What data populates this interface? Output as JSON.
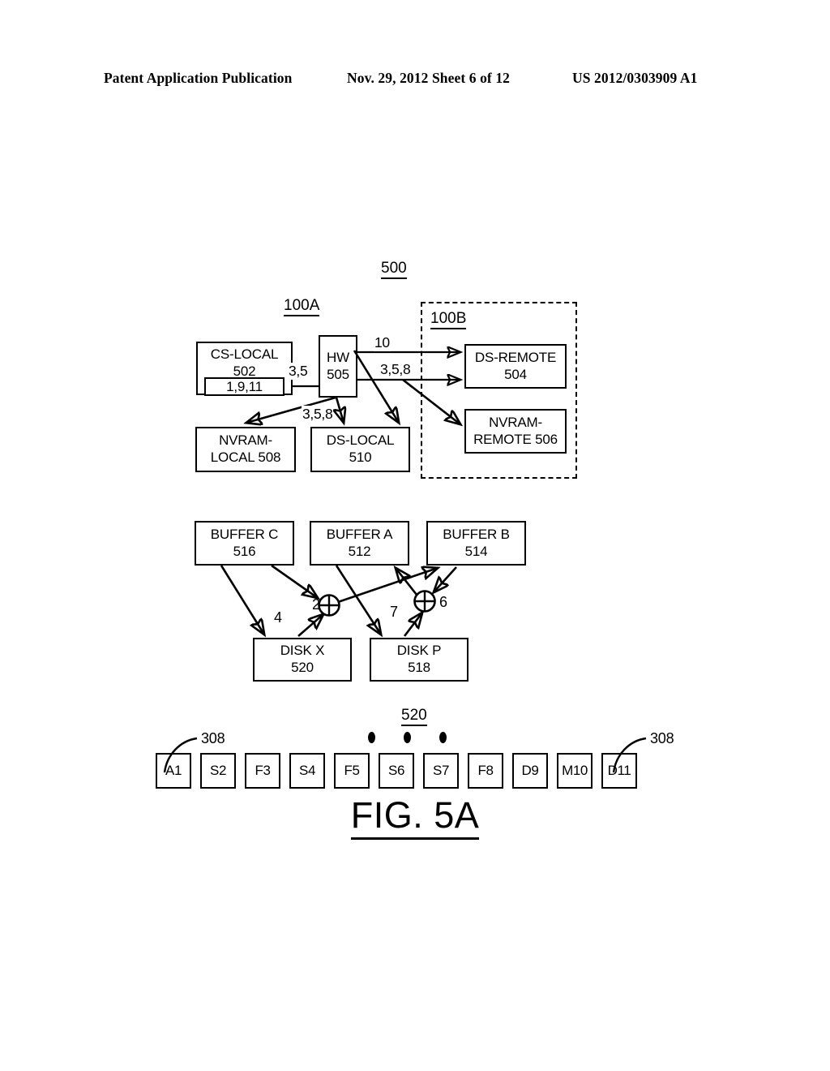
{
  "header": {
    "publication": "Patent Application Publication",
    "date_sheet": "Nov. 29, 2012  Sheet 6 of 12",
    "document_number": "US 2012/0303909 A1"
  },
  "figure": {
    "caption": "FIG. 5A",
    "system_ref": "500"
  },
  "top_diagram": {
    "node_local_label": "100A",
    "node_remote_label": "100B",
    "boxes": [
      {
        "id": "cs-local",
        "line1": "CS-LOCAL",
        "line2": "502",
        "inner": "1,9,11"
      },
      {
        "id": "hw",
        "line1": "HW",
        "line2": "505"
      },
      {
        "id": "ds-remote",
        "line1": "DS-REMOTE",
        "line2": "504"
      },
      {
        "id": "nvram-remote",
        "line1": "NVRAM-",
        "line2": "REMOTE 506"
      },
      {
        "id": "nvram-local",
        "line1": "NVRAM-",
        "line2": "LOCAL 508"
      },
      {
        "id": "ds-local",
        "line1": "DS-LOCAL",
        "line2": "510"
      }
    ],
    "edge_labels": {
      "cs_to_hw": "3,5",
      "hw_to_ds_remote_top": "10",
      "hw_to_ds_remote_bottom": "3,5,8",
      "hw_to_nvram_local": "3,5,8"
    }
  },
  "buffer_diagram": {
    "boxes": [
      {
        "id": "buffer-c",
        "line1": "BUFFER C",
        "line2": "516"
      },
      {
        "id": "buffer-a",
        "line1": "BUFFER A",
        "line2": "512"
      },
      {
        "id": "buffer-b",
        "line1": "BUFFER B",
        "line2": "514"
      },
      {
        "id": "disk-x",
        "line1": "DISK X",
        "line2": "520"
      },
      {
        "id": "disk-p",
        "line1": "DISK P",
        "line2": "518"
      }
    ],
    "xor_left_label": "2",
    "xor_right_label": "6",
    "edge_label_disk_x": "4",
    "edge_label_disk_p": "7"
  },
  "block_strip": {
    "ref": "520",
    "callout_left": "308",
    "callout_right": "308",
    "cells": [
      "A1",
      "S2",
      "F3",
      "S4",
      "F5",
      "S6",
      "S7",
      "F8",
      "D9",
      "M10",
      "D11"
    ]
  },
  "colors": {
    "ink": "#000000",
    "paper": "#ffffff"
  }
}
